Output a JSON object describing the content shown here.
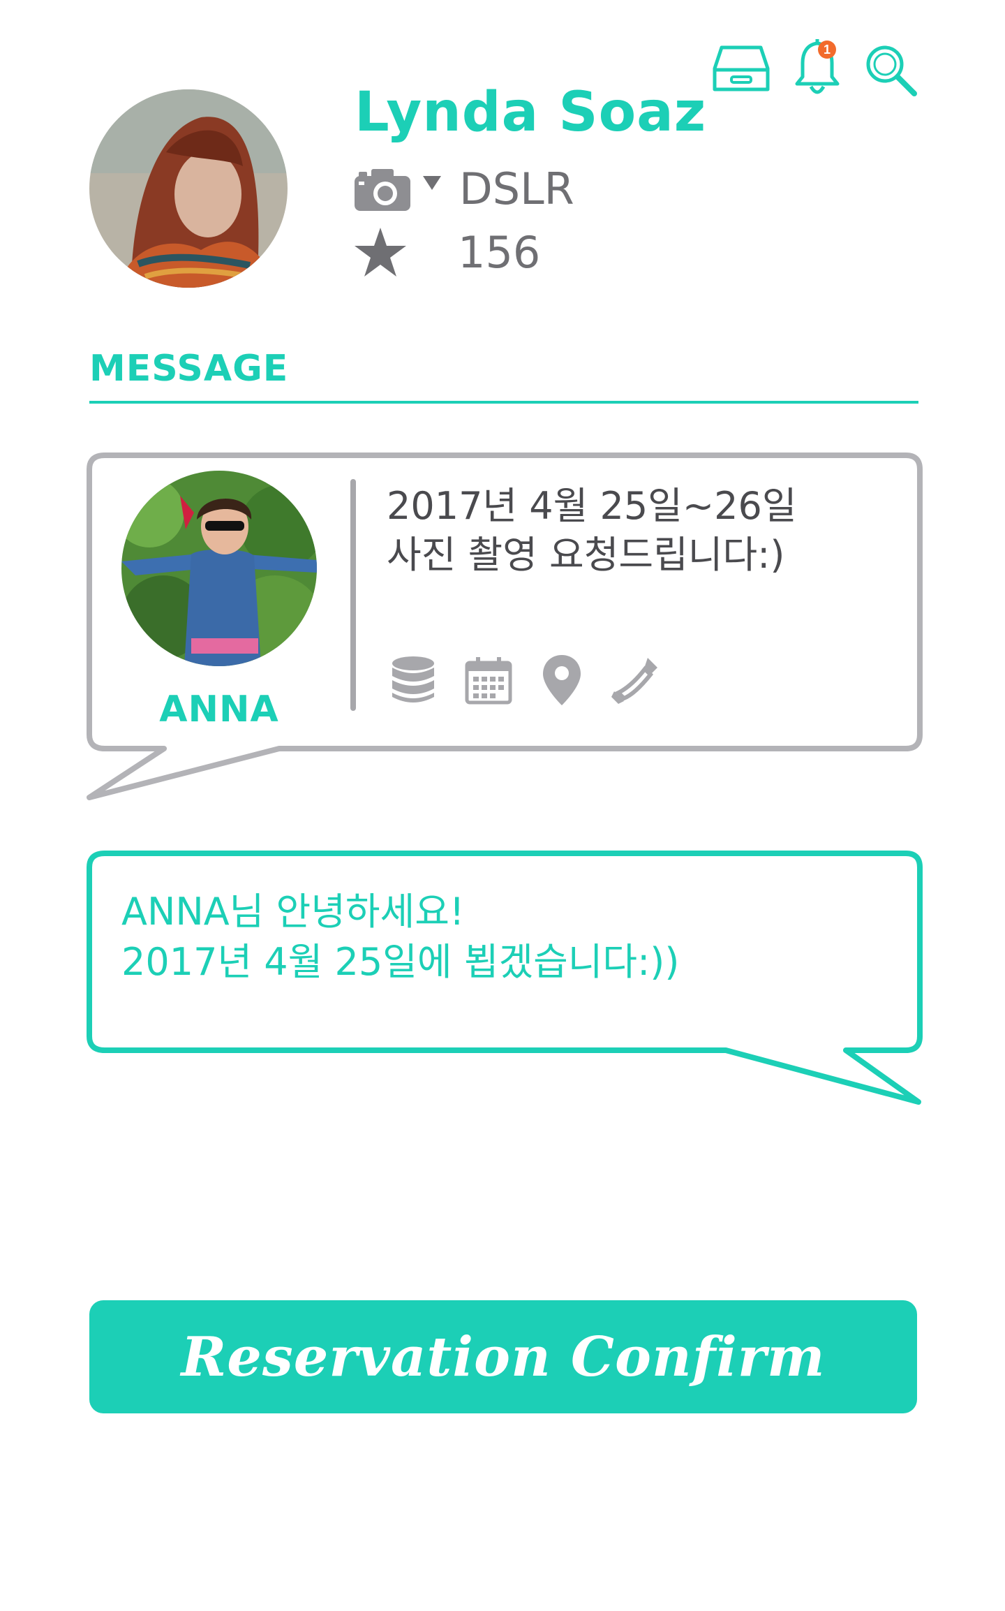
{
  "header": {
    "icons": [
      "inbox-icon",
      "bell-icon",
      "search-icon"
    ],
    "notification_count": "1"
  },
  "profile": {
    "name": "Lynda Soaz",
    "camera_type": "DSLR",
    "rating_count": "156"
  },
  "section": {
    "title": "MESSAGE"
  },
  "incoming_message": {
    "sender": "ANNA",
    "line1": "2017년 4월 25일~26일",
    "line2": "사진 촬영 요청드립니다:)",
    "icons": [
      "coins-icon",
      "calendar-icon",
      "location-pin-icon",
      "phone-icon"
    ]
  },
  "reply_message": {
    "line1": "ANNA님 안녕하세요!",
    "line2": "2017년 4월 25일에 뵙겠습니다:))"
  },
  "actions": {
    "confirm_label": "Reservation Confirm"
  },
  "colors": {
    "accent": "#1ccfb6",
    "gray": "#a7a7ab",
    "text_gray": "#6f6f73",
    "notification": "#f26b2c"
  }
}
